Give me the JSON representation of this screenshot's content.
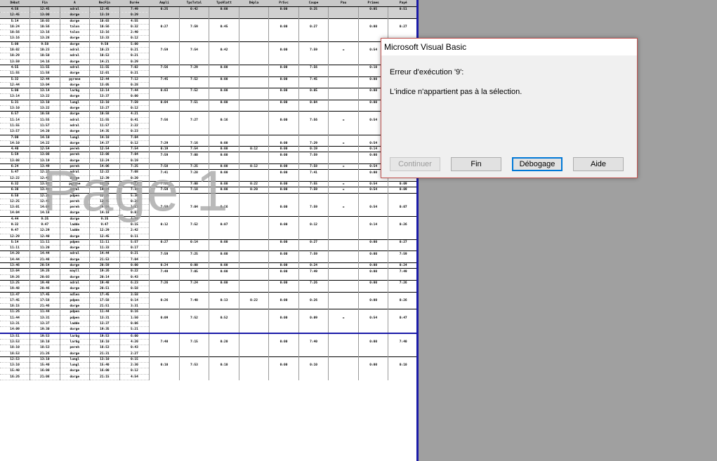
{
  "sheet": {
    "headers": [
      "Début",
      "Fin",
      "A",
      "RecFin",
      "Durée",
      "Ampli",
      "TpsTotal",
      "TpsHlatt",
      "Dépla",
      "PrSvc",
      "Coupe",
      "Pau",
      "Primes",
      "Payé"
    ],
    "rows": [
      [
        "4:56",
        "12:45",
        "ndral",
        "12:45",
        "7:49",
        "0:25",
        "0:42",
        "0:00",
        "",
        "0:00",
        "0:25",
        "",
        "0:05",
        "0:51"
      ],
      [
        "12:45",
        "13:00",
        "dorge",
        "13:19",
        "0:29",
        "",
        "",
        "",
        "",
        "",
        "",
        "",
        "",
        ""
      ],
      [
        "5:14",
        "10:03",
        "dorge",
        "10:03",
        "4:55",
        "",
        "",
        "",
        "",
        "",
        "",
        "",
        "",
        ""
      ],
      [
        "10:24",
        "10:56",
        "talon",
        "10:56",
        "0:32",
        "0:27",
        "7:59",
        "0:45",
        "",
        "0:00",
        "0:27",
        "",
        "0:00",
        "0:27"
      ],
      [
        "10:56",
        "13:16",
        "talon",
        "13:16",
        "2:40",
        "",
        "",
        "",
        "",
        "",
        "",
        "",
        "",
        ""
      ],
      [
        "13:16",
        "13:28",
        "dorge",
        "13:33",
        "0:12",
        "",
        "",
        "",
        "",
        "",
        "",
        "",
        "",
        ""
      ],
      [
        "5:00",
        "9:50",
        "dorge",
        "9:50",
        "5:00",
        "",
        "",
        "",
        "",
        "",
        "",
        "",
        "",
        ""
      ],
      [
        "10:02",
        "10:23",
        "ndral",
        "10:23",
        "0:21",
        "7:59",
        "7:54",
        "0:42",
        "",
        "0:00",
        "7:59",
        "=",
        "0:54",
        "0:38"
      ],
      [
        "10:29",
        "10:50",
        "ndral",
        "10:53",
        "0:21",
        "",
        "",
        "",
        "",
        "",
        "",
        "",
        "",
        ""
      ],
      [
        "13:59",
        "14:16",
        "dorge",
        "14:21",
        "0:29",
        "",
        "",
        "",
        "",
        "",
        "",
        "",
        "",
        ""
      ],
      [
        "4:55",
        "11:55",
        "ndral",
        "11:55",
        "7:02",
        "7:56",
        "7:29",
        "0:00",
        "",
        "0:00",
        "7:56",
        "",
        "0:10",
        "0:48"
      ],
      [
        "11:55",
        "11:58",
        "dorge",
        "12:01",
        "0:21",
        "",
        "",
        "",
        "",
        "",
        "",
        "",
        "",
        ""
      ],
      [
        "5:32",
        "12:44",
        "pyrene",
        "12:44",
        "7:12",
        "7:45",
        "7:52",
        "0:00",
        "",
        "0:00",
        "7:45",
        "",
        "0:00",
        "0:45"
      ],
      [
        "12:44",
        "13:04",
        "dorge",
        "13:05",
        "0:28",
        "",
        "",
        "",
        "",
        "",
        "",
        "",
        "",
        ""
      ],
      [
        "5:00",
        "13:14",
        "larbg",
        "13:14",
        "7:44",
        "0:03",
        "7:52",
        "0:00",
        "",
        "0:00",
        "0:05",
        "",
        "0:00",
        "0:03"
      ],
      [
        "13:14",
        "13:22",
        "dorge",
        "13:37",
        "0:00",
        "",
        "",
        "",
        "",
        "",
        "",
        "",
        "",
        ""
      ],
      [
        "5:31",
        "13:10",
        "lungl",
        "13:10",
        "7:59",
        "0:04",
        "7:51",
        "0:00",
        "",
        "0:00",
        "0:04",
        "",
        "0:00",
        "0:04"
      ],
      [
        "13:10",
        "13:22",
        "dorge",
        "13:27",
        "0:12",
        "",
        "",
        "",
        "",
        "",
        "",
        "",
        "",
        ""
      ],
      [
        "6:57",
        "10:58",
        "dorge",
        "10:58",
        "4:21",
        "",
        "",
        "",
        "",
        "",
        "",
        "",
        "",
        ""
      ],
      [
        "11:14",
        "11:55",
        "ndral",
        "11:55",
        "0:41",
        "7:56",
        "7:27",
        "0:16",
        "",
        "0:00",
        "7:56",
        "=",
        "0:54",
        "0:47"
      ],
      [
        "11:55",
        "11:57",
        "ndral",
        "11:57",
        "2:22",
        "",
        "",
        "",
        "",
        "",
        "",
        "",
        "",
        ""
      ],
      [
        "13:57",
        "14:20",
        "dorge",
        "14:35",
        "0:23",
        "",
        "",
        "",
        "",
        "",
        "",
        "",
        "",
        ""
      ],
      [
        "7:00",
        "14:10",
        "lungl",
        "14:10",
        "7:04",
        "",
        "",
        "",
        "",
        "",
        "",
        "",
        "",
        ""
      ],
      [
        "14:10",
        "14:22",
        "dorge",
        "14:37",
        "0:12",
        "7:29",
        "7:16",
        "0:00",
        "",
        "0:00",
        "7:29",
        "=",
        "0:54",
        "0:20"
      ],
      [
        "4:40",
        "12:54",
        "pereh",
        "12:54",
        "7:54",
        "0:19",
        "7:54",
        "0:00",
        "0:12",
        "0:00",
        "0:19",
        "",
        "0:14",
        "0:33"
      ],
      [
        "5:59",
        "13:08",
        "pereh",
        "13:08",
        "7:04",
        "7:59",
        "7:00",
        "0:00",
        "",
        "0:00",
        "7:59",
        "",
        "0:00",
        "7:59"
      ],
      [
        "13:08",
        "13:19",
        "dorge",
        "13:24",
        "0:19",
        "",
        "",
        "",
        "",
        "",
        "",
        "",
        "",
        ""
      ],
      [
        "6:24",
        "13:49",
        "pereh",
        "14:06",
        "7:25",
        "7:58",
        "7:25",
        "0:00",
        "0:12",
        "0:00",
        "7:58",
        "=",
        "0:54",
        "0:24"
      ],
      [
        "5:47",
        "12:22",
        "ndral",
        "12:22",
        "7:08",
        "7:41",
        "7:28",
        "0:00",
        "",
        "0:00",
        "7:41",
        "",
        "0:00",
        "0:41"
      ],
      [
        "12:22",
        "12:42",
        "dorge",
        "12:39",
        "0:20",
        "",
        "",
        "",
        "",
        "",
        "",
        "",
        "",
        ""
      ],
      [
        "6:32",
        "13:55",
        "pyrene",
        "13:55",
        "7:23",
        "7:55",
        "7:00",
        "0:00",
        "0:22",
        "0:00",
        "7:55",
        "=",
        "0:54",
        "0:09"
      ],
      [
        "6:38",
        "13:48",
        "ndral",
        "14:24",
        "7:10",
        "7:59",
        "7:18",
        "0:00",
        "0:20",
        "0:00",
        "7:59",
        "=",
        "0:54",
        "0:09"
      ],
      [
        "6:50",
        "12:25",
        "pdpen",
        "12:25",
        "5:30",
        "",
        "",
        "",
        "",
        "",
        "",
        "",
        "",
        ""
      ],
      [
        "12:25",
        "12:45",
        "pereh",
        "12:45",
        "0:20",
        "",
        "",
        "",
        "",
        "",
        "",
        "",
        "",
        ""
      ],
      [
        "13:01",
        "14:04",
        "pereh",
        "14:04",
        "1:03",
        "7:59",
        "7:04",
        "0:16",
        "",
        "0:00",
        "7:59",
        "=",
        "0:54",
        "0:07"
      ],
      [
        "14:04",
        "14:18",
        "dorge",
        "14:18",
        "0:03",
        "",
        "",
        "",
        "",
        "",
        "",
        "",
        "",
        ""
      ],
      [
        "4:44",
        "9:35",
        "dorge",
        "9:35",
        "4:44",
        "",
        "",
        "",
        "",
        "",
        "",
        "",
        "",
        ""
      ],
      [
        "9:32",
        "9:47",
        "ladde",
        "9:47",
        "0:15",
        "0:12",
        "7:52",
        "0:07",
        "",
        "0:00",
        "0:12",
        "",
        "0:14",
        "0:26"
      ],
      [
        "9:47",
        "12:29",
        "ladde",
        "12:29",
        "2:42",
        "",
        "",
        "",
        "",
        "",
        "",
        "",
        "",
        ""
      ],
      [
        "12:29",
        "12:40",
        "dorge",
        "12:45",
        "0:11",
        "",
        "",
        "",
        "",
        "",
        "",
        "",
        "",
        ""
      ],
      [
        "5:14",
        "11:11",
        "pdpen",
        "11:11",
        "5:57",
        "0:27",
        "0:14",
        "0:00",
        "",
        "0:00",
        "0:27",
        "",
        "0:00",
        "0:27"
      ],
      [
        "11:11",
        "11:20",
        "dorge",
        "11:33",
        "0:17",
        "",
        "",
        "",
        "",
        "",
        "",
        "",
        "",
        ""
      ],
      [
        "14:20",
        "14:44",
        "ndral",
        "14:44",
        "0:21",
        "7:59",
        "7:25",
        "0:00",
        "",
        "0:00",
        "7:59",
        "",
        "0:00",
        "7:59"
      ],
      [
        "14:44",
        "21:48",
        "dorge",
        "21:53",
        "7:04",
        "",
        "",
        "",
        "",
        "",
        "",
        "",
        "",
        ""
      ],
      [
        "13:46",
        "20:54",
        "dorge",
        "20:59",
        "0:00",
        "0:24",
        "0:00",
        "0:00",
        "",
        "0:00",
        "0:24",
        "",
        "0:00",
        "0:24"
      ],
      [
        "13:04",
        "19:26",
        "mayll",
        "19:26",
        "0:22",
        "7:49",
        "7:05",
        "0:00",
        "",
        "0:00",
        "7:49",
        "",
        "0:00",
        "7:49"
      ],
      [
        "19:26",
        "20:03",
        "dorge",
        "20:14",
        "0:43",
        "",
        "",
        "",
        "",
        "",
        "",
        "",
        "",
        ""
      ],
      [
        "13:25",
        "19:48",
        "ndral",
        "19:48",
        "6:23",
        "7:26",
        "7:24",
        "0:00",
        "",
        "0:00",
        "7:26",
        "",
        "0:00",
        "7:26"
      ],
      [
        "19:48",
        "20:46",
        "dorge",
        "20:51",
        "0:58",
        "",
        "",
        "",
        "",
        "",
        "",
        "",
        "",
        ""
      ],
      [
        "13:47",
        "17:45",
        "ndlen",
        "17:45",
        "3:58",
        "",
        "",
        "",
        "",
        "",
        "",
        "",
        "",
        ""
      ],
      [
        "17:45",
        "17:58",
        "pdpen",
        "17:58",
        "0:14",
        "0:26",
        "7:40",
        "0:13",
        "0:22",
        "0:00",
        "0:26",
        "",
        "0:00",
        "0:26"
      ],
      [
        "18:15",
        "21:46",
        "dorge",
        "21:51",
        "3:31",
        "",
        "",
        "",
        "",
        "",
        "",
        "",
        "",
        ""
      ],
      [
        "11:26",
        "11:44",
        "pdpen",
        "11:44",
        "0:16",
        "",
        "",
        "",
        "",
        "",
        "",
        "",
        "",
        ""
      ],
      [
        "11:44",
        "13:31",
        "pdpen",
        "13:31",
        "1:50",
        "0:09",
        "7:52",
        "0:52",
        "",
        "0:00",
        "0:09",
        "=",
        "0:54",
        "0:47"
      ],
      [
        "13:31",
        "13:37",
        "ladde",
        "13:37",
        "0:06",
        "",
        "",
        "",
        "",
        "",
        "",
        "",
        "",
        ""
      ],
      [
        "14:09",
        "19:30",
        "dorge",
        "19:35",
        "5:21",
        "",
        "",
        "",
        "",
        "",
        "",
        "",
        "",
        ""
      ],
      [
        "13:51",
        "19:53",
        "larbg",
        "19:53",
        "6:00",
        "",
        "",
        "",
        "",
        "",
        "",
        "",
        "",
        ""
      ],
      [
        "13:53",
        "18:10",
        "larbg",
        "18:10",
        "4:20",
        "7:40",
        "7:15",
        "0:20",
        "",
        "0:00",
        "7:40",
        "",
        "0:00",
        "7:40"
      ],
      [
        "18:10",
        "18:53",
        "pereh",
        "18:53",
        "0:43",
        "",
        "",
        "",
        "",
        "",
        "",
        "",
        "",
        ""
      ],
      [
        "18:53",
        "21:26",
        "dorge",
        "21:31",
        "2:27",
        "",
        "",
        "",
        "",
        "",
        "",
        "",
        "",
        ""
      ],
      [
        "12:53",
        "13:10",
        "lungl",
        "13:10",
        "0:15",
        "",
        "",
        "",
        "",
        "",
        "",
        "",
        "",
        ""
      ],
      [
        "13:10",
        "15:40",
        "lungl",
        "15:40",
        "2:30",
        "0:10",
        "7:53",
        "0:10",
        "",
        "0:00",
        "0:10",
        "",
        "0:00",
        "0:10"
      ],
      [
        "15:40",
        "16:00",
        "dorge",
        "16:00",
        "0:12",
        "",
        "",
        "",
        "",
        "",
        "",
        "",
        "",
        ""
      ],
      [
        "16:26",
        "21:08",
        "dorge",
        "21:15",
        "4:54",
        "",
        "",
        "",
        "",
        "",
        "",
        "",
        "",
        ""
      ]
    ]
  },
  "watermark": "Page 1",
  "dialog": {
    "title": "Microsoft Visual Basic",
    "error_line": "Erreur d'exécution '9':",
    "message": "L'indice n'appartient pas à la sélection.",
    "buttons": {
      "continue": "Continuer",
      "end": "Fin",
      "debug": "Débogage",
      "help": "Aide"
    }
  },
  "colors": {
    "accent": "#0078d7",
    "dialog_border": "#c0504d",
    "page_border": "#1a1aa8"
  }
}
